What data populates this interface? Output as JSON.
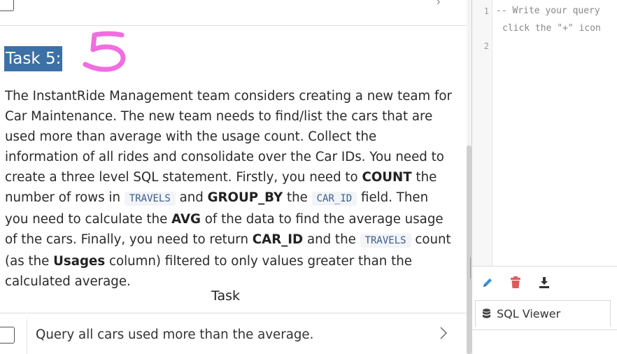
{
  "task": {
    "heading": "Task 5:",
    "paragraph": {
      "s1": "The InstantRide Management team considers creating a new team for Car Maintenance. The new team needs to find/list the cars that are used more than average with the usage count. Collect the information of all rides and consolidate over the Car IDs. You need to create a three level SQL statement. Firstly, you need to ",
      "count_kw": "COUNT",
      "s2": " the number of rows in ",
      "travels_code": "TRAVELS",
      "s3": " and ",
      "group_kw": "GROUP_BY",
      "s4": " the ",
      "car_id_code": "CAR_ID",
      "s5": " field. Then you need to calculate the ",
      "avg_kw": "AVG",
      "s6": " of the data to find the average usage of the cars. Finally, you need to return ",
      "car_id_kw": "CAR_ID",
      "s7": " and the ",
      "travels_code2": "TRAVELS",
      "s8": " count (as the ",
      "usages_kw": "Usages",
      "s9": " column) filtered to only values greater than the calculated average."
    },
    "section_title": "Task",
    "item_label": "Query all cars used more than the average."
  },
  "annotation": {
    "digit": "5",
    "color": "#f06ee0"
  },
  "editor": {
    "lines": [
      {
        "num": "1",
        "text": "-- Write your query"
      },
      {
        "num": "",
        "text": "click the \"+\" icon"
      },
      {
        "num": "2",
        "text": ""
      }
    ]
  },
  "toolbar": {
    "icons": [
      "pencil-icon",
      "trash-icon",
      "download-icon"
    ],
    "colors": {
      "pencil": "#3d8fd1",
      "trash": "#e05a5a",
      "download": "#333333"
    }
  },
  "viewer": {
    "tab_label": "SQL Viewer"
  },
  "colors": {
    "heading_bg": "#3c70a6",
    "code_fg": "#3a5c8e",
    "code_bg": "#f2f4f7"
  }
}
